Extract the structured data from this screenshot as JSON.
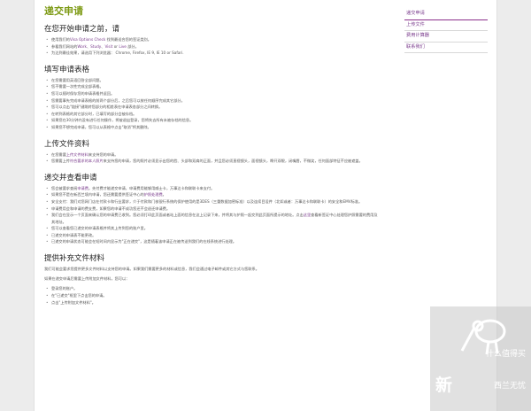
{
  "page_title": "递交申请",
  "sidebar": {
    "items": [
      {
        "label": "递交申请"
      },
      {
        "label": "上传文件"
      },
      {
        "label": "费用计算器"
      },
      {
        "label": "联系我们"
      }
    ]
  },
  "sections": {
    "s1": {
      "title": "在您开始申请之前，请",
      "i1a": "使用我们的",
      "i1link": "Visa Options Check",
      "i1b": " 找到最适合您的签证类别。",
      "i2a": "参看我们网站的",
      "i2l1": "Work",
      "i2s1": "、",
      "i2l2": "Study",
      "i2s2": "、",
      "i2l3": "Visit",
      "i2s3": " or ",
      "i2l4": "Live",
      "i2b": " 部分。",
      "i3": "为达到最佳效果，请选用下列浏览器： Chrome, Firefox, IE 9, IE 10 or Safari."
    },
    "s2": {
      "title": "填写申请表格",
      "i1": "在您需要用英语回答全部问题。",
      "i2": "您不需要一次性完成全部表格。",
      "i3": "您可以随时保存您的申请表格并返回。",
      "i4": "您需要事先完成申请表格的前两个部分后，之后您可以按任何顺序完成其它部分。",
      "i5": "您可以点击\"链接\"键跳转您部分的相差表在申请表各部分之间转换。",
      "i6": "在转到表格的其它部分时，已填写的部分会被存档。",
      "i7": "如果您在30分钟内没有进行任何操作，将被退出登录，您将失去所有未被存档的信息。",
      "i8": "如果您不想完成申请，您可以从表格中点击\"取消\"将其删除。"
    },
    "s3": {
      "title": "上传文件资料",
      "i1a": "在您需要",
      "i1link": "上传文件材料",
      "i1b": "来支持您的申请。",
      "i2a": "您需要上传",
      "i2link": "符合要求的本人照片",
      "i2b": "来支持您的申请，您的照片必须显示出您的脸、头部和双肩的正面，并且您必须直视镜头，面视镜头，睁开双眼，闭嘴唇，不微笑，任何面部特征不应被遮盖。"
    },
    "s4": {
      "title": "递交并查看申请",
      "i1a": "您会被要求查阅",
      "i1link": "申请费",
      "i1b": "。先付费才能递交申请，申请费用能够用威士卡，万事达卡和联联卡来支付。",
      "i2a": "如果您不是在新西兰境内申请，您还需要提供签证中心的",
      "i2link": "护照处理费",
      "i2b": "。",
      "i3": "安全支付：我们对您网门店在付款卡和行业要求，介于付款和门核银行系统的保护使用的是3DES（三重数据加密标准）以及连续目设件（北如或者：万事达卡和联联卡）的安全和EMV标准。",
      "i4": "申请费用会和申请的费支费，如果您的申请不成功您还不会退还申请费。",
      "i5a": "我们会在显示一个页面来确认您的申请费已收到。您必须打印此页面或者站上面的信息在这上记录下来，并将其与护照一起交到此页面所提示的地址。点击",
      "i5link": "这里",
      "i5b": "查看新签证中心处理您护照需要的费用及其地址。",
      "i6": "您可以查看您已递交的申请表格并将其上传到您的账户里。",
      "i7": "已递交的申请表不能更改。",
      "i8": "已递交的申请状态可能会在短时间内显示为\"正在递交\"，这是随着该申请正在被传送到我们的在线系统进行处理。"
    },
    "s5": {
      "title": "提供补充文件材料",
      "p1": "我们可能会要求您提供更多文件材料以支持您的申请。如果我们需要更多的材料或信息，我们会通过电子邮件或其它方式与您联系。",
      "p2": "如果在递交申请后需要上传附加文件材料，您可以：",
      "i1": "登录您的账户。",
      "i2": "在\"已递交\"框里下点击您的申请。",
      "i3": "点击\"上传附加文件材料\"。"
    }
  },
  "watermark": {
    "line1": "什么值得买",
    "line2": "新",
    "line3": "西兰无忧"
  }
}
